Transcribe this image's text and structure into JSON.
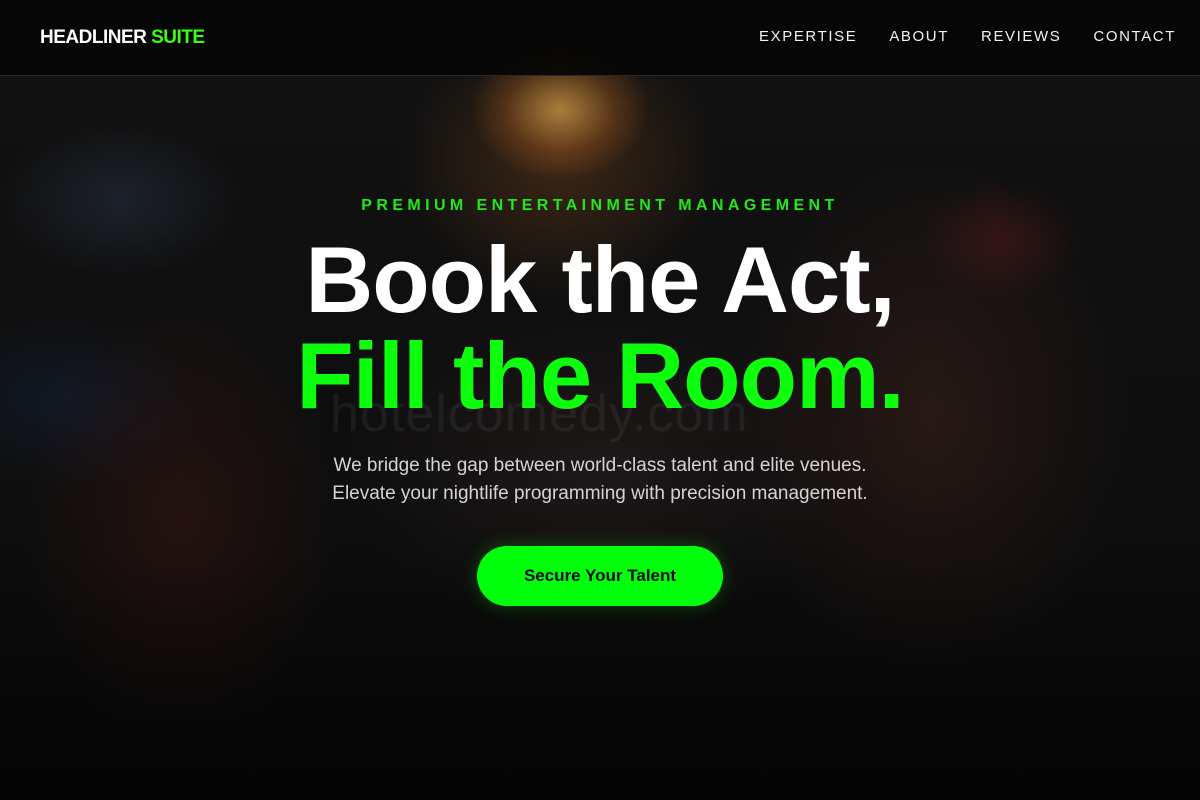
{
  "header": {
    "logo_main": "HEADLINER ",
    "logo_accent": "SUITE",
    "nav": [
      {
        "label": "EXPERTISE"
      },
      {
        "label": "ABOUT"
      },
      {
        "label": "REVIEWS"
      },
      {
        "label": "CONTACT"
      }
    ]
  },
  "hero": {
    "eyebrow": "PREMIUM ENTERTAINMENT MANAGEMENT",
    "headline_line1": "Book the Act,",
    "headline_line2": "Fill the Room.",
    "subtext_line1": "We bridge the gap between world-class talent and elite venues.",
    "subtext_line2": "Elevate your nightlife programming with precision management.",
    "cta_label": "Secure Your Talent",
    "watermark": "hotelcomedy.com"
  },
  "colors": {
    "accent": "#39ff14",
    "background": "#0b0b0b",
    "text": "#ffffff"
  }
}
